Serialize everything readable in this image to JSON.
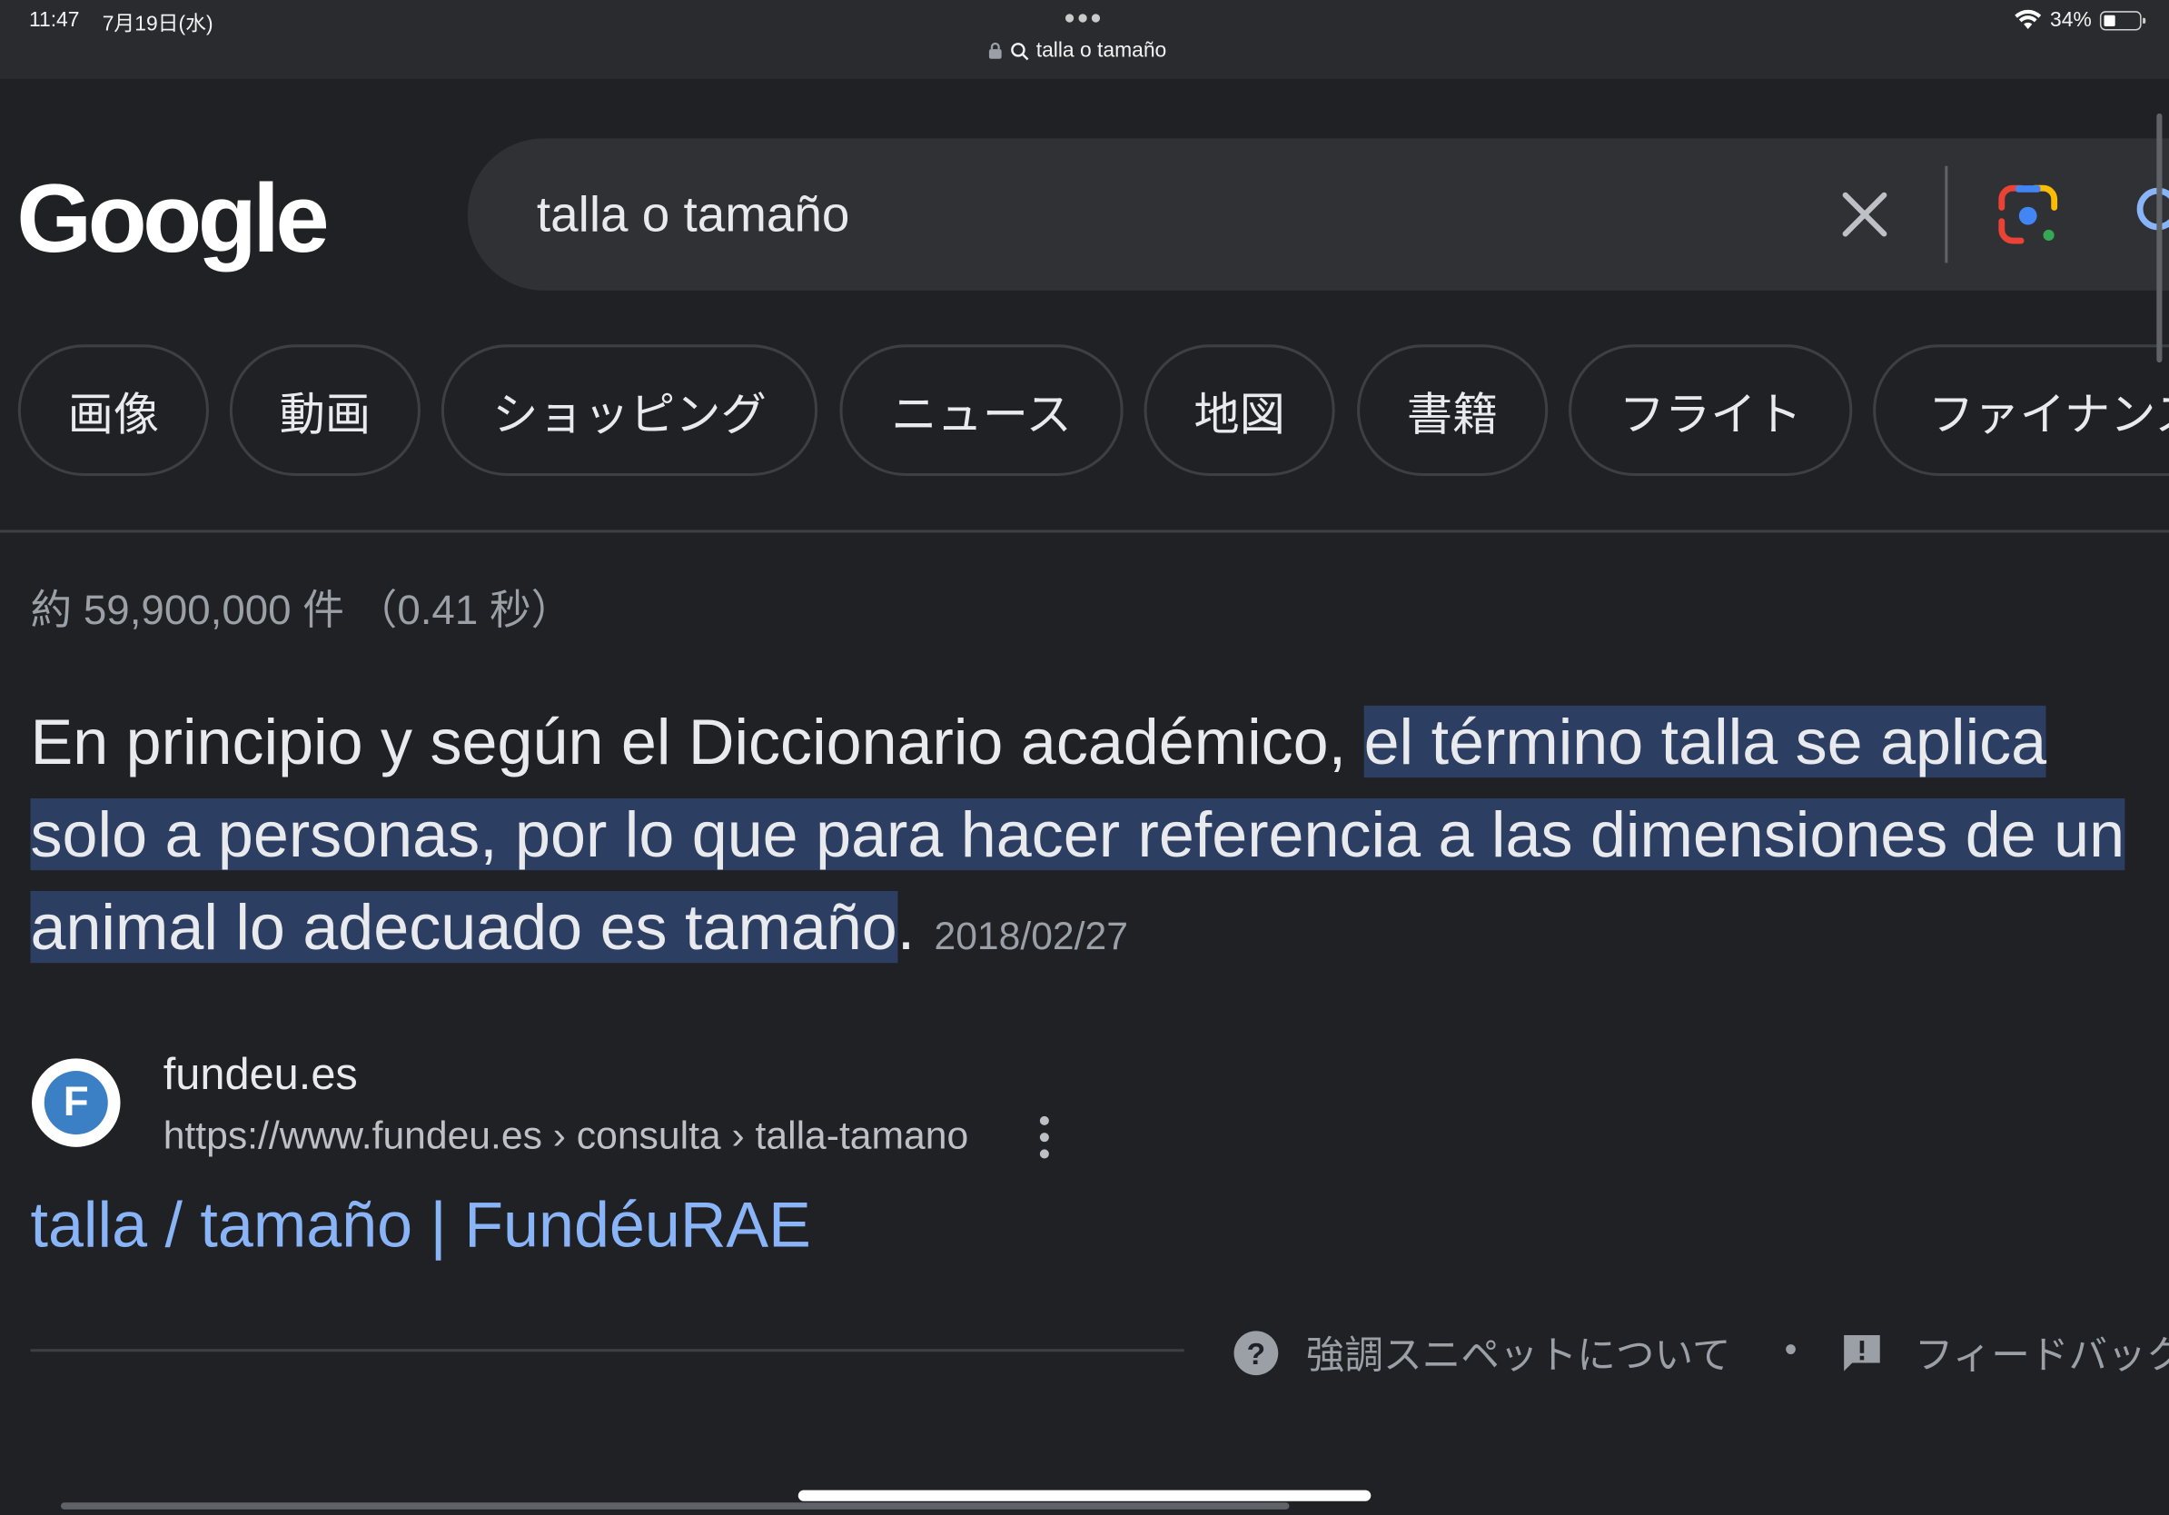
{
  "status_bar": {
    "time": "11:47",
    "date": "7月19日(水)",
    "url_text": "talla o tamaño",
    "battery": "34%",
    "battery_level": 0.34
  },
  "header": {
    "logo": "Google",
    "search_value": "talla o tamaño"
  },
  "chips": [
    "画像",
    "動画",
    "ショッピング",
    "ニュース",
    "地図",
    "書籍",
    "フライト",
    "ファイナンス"
  ],
  "results_stats": "約 59,900,000 件 （0.41 秒）",
  "featured_snippet": {
    "text_plain": "En principio y según el Diccionario académico, ",
    "text_highlight": "el término talla se aplica solo a personas, por lo que para hacer referencia a las dimensiones de un animal lo adecuado es tamaño",
    "text_end": ".",
    "date": "2018/02/27"
  },
  "source": {
    "favicon_letter": "F",
    "site_name": "fundeu.es",
    "url": "https://www.fundeu.es › consulta › talla-tamano",
    "title": "talla / tamaño | FundéuRAE"
  },
  "footer": {
    "about_label": "強調スニペットについて",
    "bullet": "•",
    "feedback_label": "フィードバック"
  },
  "colors": {
    "background": "#202124",
    "link": "#8ab4f8",
    "highlight": "#2d3e63"
  }
}
